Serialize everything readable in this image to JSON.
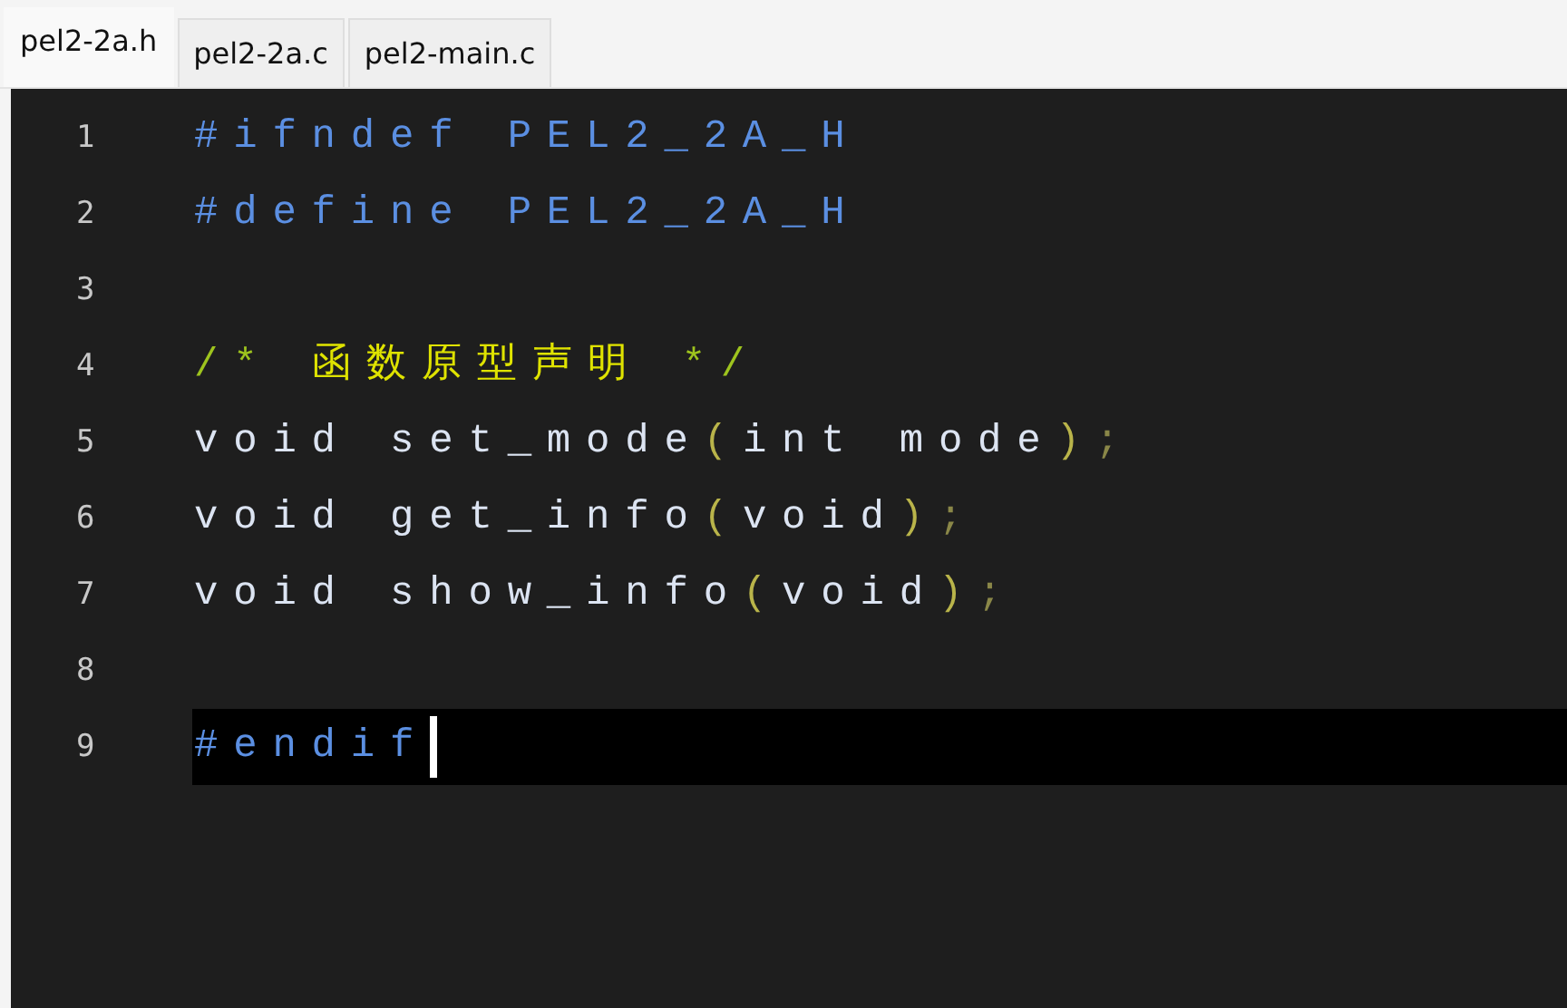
{
  "tabs": [
    {
      "label": "pel2-2a.h",
      "selected": true
    },
    {
      "label": "pel2-2a.c",
      "selected": false
    },
    {
      "label": "pel2-main.c",
      "selected": false
    }
  ],
  "editor": {
    "lines": [
      {
        "number": "1",
        "current": false,
        "tokens": [
          {
            "kind": "preproc",
            "text": "#ifndef PEL2_2A_H"
          }
        ]
      },
      {
        "number": "2",
        "current": false,
        "tokens": [
          {
            "kind": "preproc",
            "text": "#define PEL2_2A_H"
          }
        ]
      },
      {
        "number": "3",
        "current": false
      },
      {
        "number": "4",
        "current": false,
        "tokens": [
          {
            "kind": "comment-mark",
            "text": "/*"
          },
          {
            "kind": "comment",
            "text": " 函数原型声明 "
          },
          {
            "kind": "comment-mark",
            "text": "*/"
          }
        ]
      },
      {
        "number": "5",
        "current": false,
        "tokens": [
          {
            "kind": "plain",
            "text": "void set_mode"
          },
          {
            "kind": "paren",
            "text": "("
          },
          {
            "kind": "plain",
            "text": "int mode"
          },
          {
            "kind": "paren",
            "text": ")"
          },
          {
            "kind": "punct",
            "text": ";"
          }
        ]
      },
      {
        "number": "6",
        "current": false,
        "tokens": [
          {
            "kind": "plain",
            "text": "void get_info"
          },
          {
            "kind": "paren",
            "text": "("
          },
          {
            "kind": "plain",
            "text": "void"
          },
          {
            "kind": "paren",
            "text": ")"
          },
          {
            "kind": "punct",
            "text": ";"
          }
        ]
      },
      {
        "number": "7",
        "current": false,
        "tokens": [
          {
            "kind": "plain",
            "text": "void show_info"
          },
          {
            "kind": "paren",
            "text": "("
          },
          {
            "kind": "plain",
            "text": "void"
          },
          {
            "kind": "paren",
            "text": ")"
          },
          {
            "kind": "punct",
            "text": ";"
          }
        ]
      },
      {
        "number": "8",
        "current": false
      },
      {
        "number": "9",
        "current": true,
        "tokens": [
          {
            "kind": "preproc",
            "text": "#endif"
          }
        ]
      }
    ]
  }
}
